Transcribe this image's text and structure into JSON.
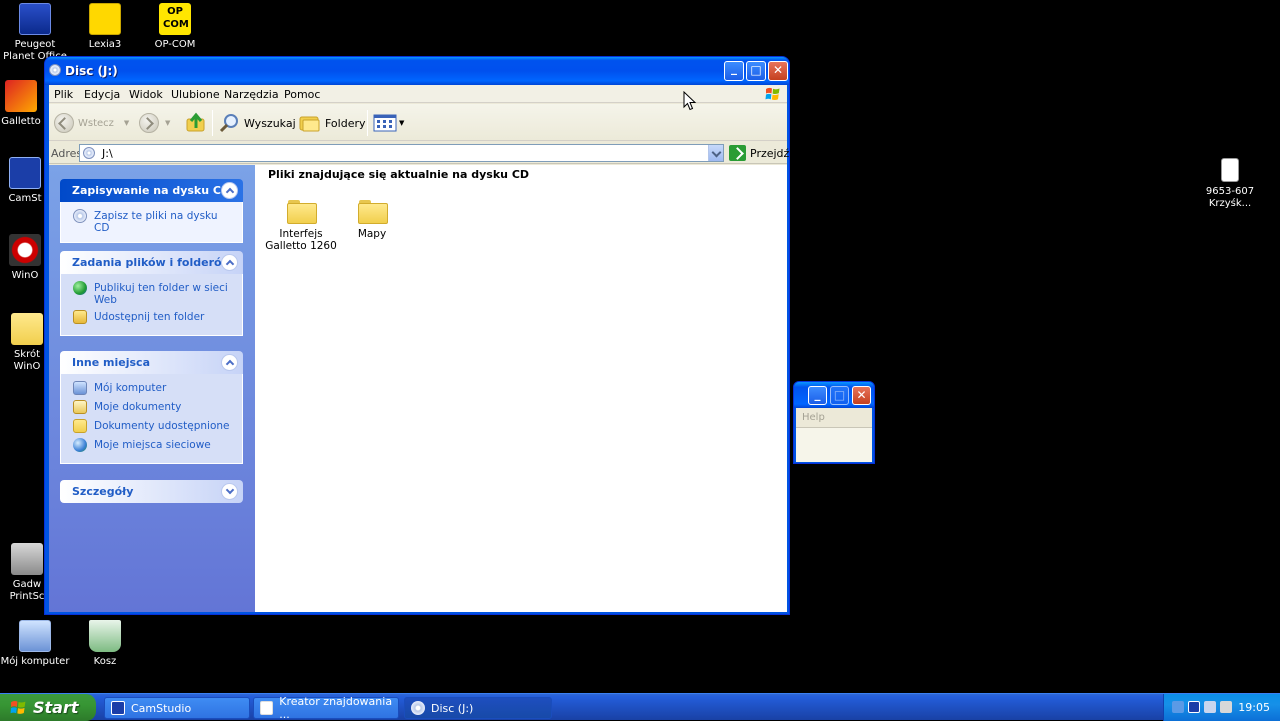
{
  "desktop": {
    "icons": [
      {
        "label": "Peugeot Planet Office"
      },
      {
        "label": "Lexia3"
      },
      {
        "label": "OP-COM"
      },
      {
        "label": "Galletto"
      },
      {
        "label": "CamSt"
      },
      {
        "label": "WinO"
      },
      {
        "label": "Skrót WinO"
      },
      {
        "label": "Gadw PrintSc"
      },
      {
        "label": "Mój komputer"
      },
      {
        "label": "Kosz"
      },
      {
        "label": "9653-607 Krzyśk..."
      }
    ],
    "opcom_badge": "OP COM"
  },
  "window": {
    "title": "Disc (J:)",
    "menu": [
      "Plik",
      "Edycja",
      "Widok",
      "Ulubione",
      "Narzędzia",
      "Pomoc"
    ],
    "toolbar": {
      "back": "Wstecz",
      "search": "Wyszukaj",
      "folders": "Foldery"
    },
    "address": {
      "label": "Adres",
      "value": "J:\\",
      "go": "Przejdź"
    },
    "tasks": {
      "cd_panel": {
        "title": "Zapisywanie na dysku CD",
        "links": [
          "Zapisz te pliki na dysku CD"
        ]
      },
      "file_panel": {
        "title": "Zadania plików i folderów",
        "links": [
          "Publikuj ten folder w sieci Web",
          "Udostępnij ten folder"
        ]
      },
      "places_panel": {
        "title": "Inne miejsca",
        "links": [
          "Mój komputer",
          "Moje dokumenty",
          "Dokumenty udostępnione",
          "Moje miejsca sieciowe"
        ]
      },
      "details_panel": {
        "title": "Szczegóły"
      }
    },
    "content": {
      "group_title": "Pliki znajdujące się aktualnie na dysku CD",
      "items": [
        {
          "label": "Interfejs Galletto 1260"
        },
        {
          "label": "Mapy"
        }
      ]
    }
  },
  "mini_window": {
    "menu": "Help"
  },
  "taskbar": {
    "start": "Start",
    "tasks": [
      {
        "label": "CamStudio"
      },
      {
        "label": "Kreator znajdowania ..."
      },
      {
        "label": "Disc (J:)"
      }
    ],
    "clock": "19:05"
  }
}
